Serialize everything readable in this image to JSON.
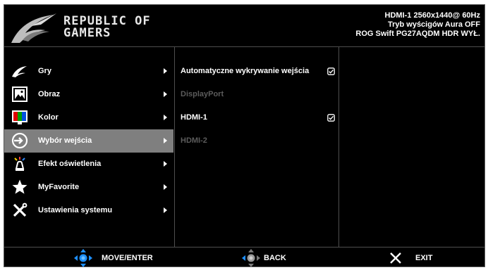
{
  "header": {
    "brand_line1": "REPUBLIC OF",
    "brand_line2": "GAMERS",
    "status_line1": "HDMI-1  2560x1440@  60Hz",
    "status_line2": "Tryb wyścigów   Aura OFF",
    "status_line3": "ROG Swift   PG27AQDM   HDR WYŁ."
  },
  "menu": {
    "items": [
      {
        "label": "Gry",
        "icon": "rog-eye-icon"
      },
      {
        "label": "Obraz",
        "icon": "picture-icon"
      },
      {
        "label": "Kolor",
        "icon": "color-bars-icon"
      },
      {
        "label": "Wybór wejścia",
        "icon": "input-select-icon",
        "active": true
      },
      {
        "label": "Efekt oświetlenia",
        "icon": "light-effect-icon"
      },
      {
        "label": "MyFavorite",
        "icon": "star-icon"
      },
      {
        "label": "Ustawienia systemu",
        "icon": "tools-icon"
      }
    ]
  },
  "submenu": {
    "items": [
      {
        "label": "Automatyczne wykrywanie wejścia",
        "checked": true,
        "enabled": true
      },
      {
        "label": "DisplayPort",
        "checked": false,
        "enabled": false
      },
      {
        "label": "HDMI-1",
        "checked": true,
        "enabled": true
      },
      {
        "label": "HDMI-2",
        "checked": false,
        "enabled": false
      }
    ]
  },
  "footer": {
    "move_label": "MOVE/ENTER",
    "back_label": "BACK",
    "exit_label": "EXIT"
  },
  "colors": {
    "background": "#000000",
    "active_row": "#7f7f7f",
    "divider": "#4e4e4e",
    "nav_accent": "#1e90ff",
    "disabled_text": "#5c5c5c"
  }
}
